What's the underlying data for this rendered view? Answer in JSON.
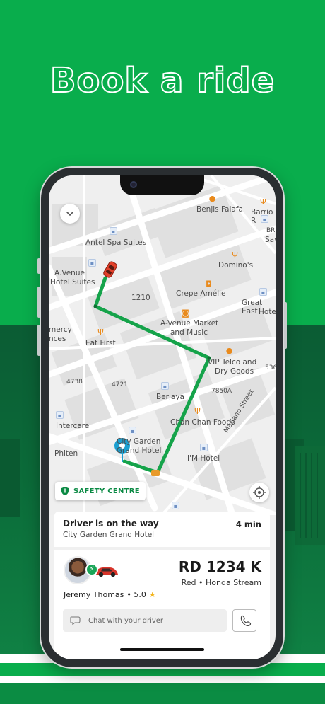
{
  "headline": "Book a ride",
  "map": {
    "labels": [
      {
        "key": "benjis",
        "text": "Benjis Falafal"
      },
      {
        "key": "barrio",
        "text": "Barrio R"
      },
      {
        "key": "antel",
        "text": "Antel Spa Suites"
      },
      {
        "key": "avenue_suites_1",
        "text": "A.Venue"
      },
      {
        "key": "avenue_suites_2",
        "text": "Hotel Suites"
      },
      {
        "key": "dominos",
        "text": "Domino's"
      },
      {
        "key": "crepe",
        "text": "Crepe Amélie"
      },
      {
        "key": "n1210",
        "text": "1210"
      },
      {
        "key": "great_east_1",
        "text": "Great East"
      },
      {
        "key": "great_east_2",
        "text": "Hotel"
      },
      {
        "key": "avenue_market_1",
        "text": "A-Venue Market"
      },
      {
        "key": "avenue_market_2",
        "text": "and Music"
      },
      {
        "key": "mercy_1",
        "text": "mercy"
      },
      {
        "key": "mercy_2",
        "text": "nces"
      },
      {
        "key": "eat_first",
        "text": "Eat First"
      },
      {
        "key": "vip_telco_1",
        "text": "VIP Telco and"
      },
      {
        "key": "vip_telco_2",
        "text": "Dry Goods"
      },
      {
        "key": "n536",
        "text": "536"
      },
      {
        "key": "n4738",
        "text": "4738"
      },
      {
        "key": "n4721",
        "text": "4721"
      },
      {
        "key": "berjaya",
        "text": "Berjaya"
      },
      {
        "key": "n7850a",
        "text": "7850A"
      },
      {
        "key": "chan_chan",
        "text": "Chan Chan Foods"
      },
      {
        "key": "mariano",
        "text": "Mariano Street"
      },
      {
        "key": "intercare",
        "text": "Intercare"
      },
      {
        "key": "city_garden_1",
        "text": "City Garden"
      },
      {
        "key": "city_garden_2",
        "text": "Grand Hotel"
      },
      {
        "key": "phiten",
        "text": "Phiten"
      },
      {
        "key": "im_hotel",
        "text": "I'M Hotel"
      },
      {
        "key": "br",
        "text": "BR"
      },
      {
        "key": "sav",
        "text": "Sav"
      }
    ]
  },
  "safety_label": "SAFETY CENTRE",
  "status": {
    "title": "Driver is on the way",
    "location": "City Garden Grand Hotel",
    "eta": "4 min"
  },
  "driver": {
    "plate": "RD 1234 K",
    "car": "Red • Honda Stream",
    "name": "Jeremy Thomas",
    "rating": "• 5.0"
  },
  "chat_placeholder": "Chat with your driver",
  "icons": {
    "back": "chevron-down-icon",
    "safety": "shield-icon",
    "locate": "crosshair-icon",
    "chat": "chat-bubble-icon",
    "call": "phone-icon",
    "star": "star-icon",
    "badge": "lightning-icon"
  },
  "colors": {
    "brand_green": "#09ad4c",
    "route_green": "#15a34a",
    "pickup_blue": "#1a9fd0",
    "car_red": "#e2402a"
  }
}
